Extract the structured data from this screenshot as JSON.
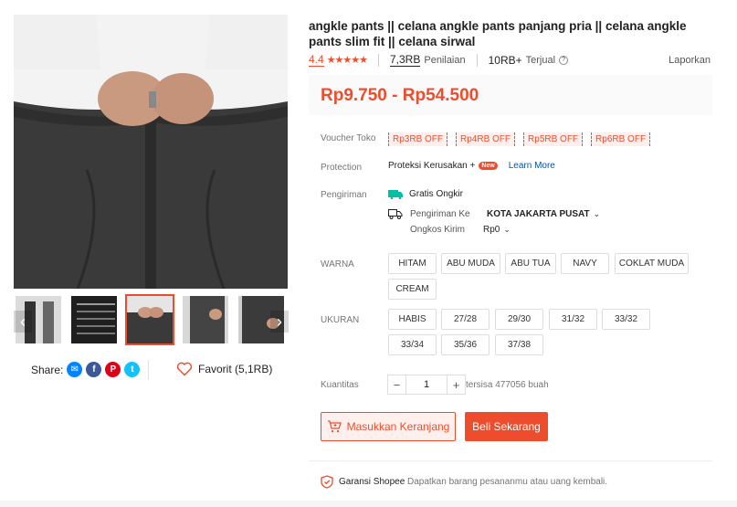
{
  "product": {
    "title": "angkle pants || celana angkle pants panjang pria || celana angkle pants slim fit || celana sirwal",
    "rating": "4.4",
    "stars": "★★★★★",
    "reviews_count": "7,3RB",
    "reviews_label": "Penilaian",
    "sold_count": "10RB+",
    "sold_label": "Terjual",
    "report_label": "Laporkan",
    "price": "Rp9.750 - Rp54.500"
  },
  "voucher": {
    "label": "Voucher Toko",
    "items": [
      "Rp3RB OFF",
      "Rp4RB OFF",
      "Rp5RB OFF",
      "Rp6RB OFF"
    ]
  },
  "protection": {
    "label": "Protection",
    "text": "Proteksi Kerusakan +",
    "badge": "New",
    "link": "Learn More"
  },
  "shipping": {
    "label": "Pengiriman",
    "free": "Gratis Ongkir",
    "to_label": "Pengiriman Ke",
    "to_value": "KOTA JAKARTA PUSAT",
    "cost_label": "Ongkos Kirim",
    "cost_value": "Rp0"
  },
  "color": {
    "label": "WARNA",
    "options": [
      "HITAM",
      "ABU MUDA",
      "ABU TUA",
      "NAVY",
      "COKLAT MUDA",
      "CREAM"
    ]
  },
  "size": {
    "label": "UKURAN",
    "options": [
      "HABIS",
      "27/28",
      "29/30",
      "31/32",
      "33/32",
      "33/34",
      "35/36",
      "37/38"
    ]
  },
  "quantity": {
    "label": "Kuantitas",
    "value": "1",
    "minus": "−",
    "plus": "+",
    "stock": "tersisa 477056 buah"
  },
  "actions": {
    "add_to_cart": "Masukkan Keranjang",
    "buy_now": "Beli Sekarang"
  },
  "guarantee": {
    "label": "Garansi Shopee",
    "desc": "Dapatkan barang pesananmu atau uang kembali."
  },
  "share": {
    "label": "Share:",
    "favorite": "Favorit (5,1RB)"
  },
  "colors": {
    "accent": "#ee4d2d",
    "link": "#0055aa",
    "teal": "#00bfa5"
  }
}
